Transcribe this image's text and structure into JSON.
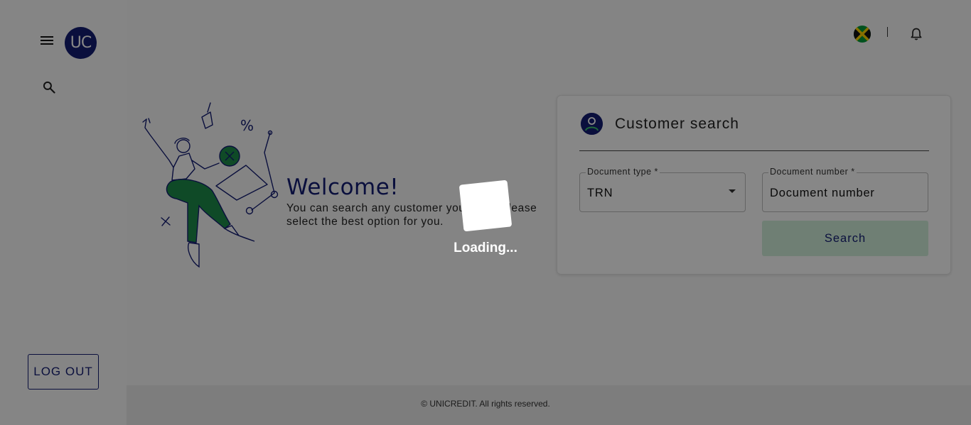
{
  "sidebar": {
    "logo_text": "UC",
    "menu_icon": "hamburger-menu-icon",
    "search_icon": "search-icon",
    "logout_label": "LOG OUT"
  },
  "topbar": {
    "flag_icon": "jamaica-flag-icon",
    "separator": "|",
    "bell_icon": "bell-icon"
  },
  "welcome": {
    "title": "Welcome!",
    "text": "You can search any customer you need, please select the best option for you."
  },
  "customer_search": {
    "title": "Customer search",
    "icon": "user-circle-icon",
    "document_type": {
      "label": "Document type *",
      "value": "TRN"
    },
    "document_number": {
      "label": "Document number *",
      "placeholder": "Document number"
    },
    "search_label": "Search"
  },
  "footer": {
    "text": "© UNICREDIT. All rights reserved."
  },
  "loading": {
    "text": "Loading..."
  },
  "colors": {
    "brand": "#141e74",
    "accent_green": "#1e8c4a",
    "search_button": "#d1f0dc"
  }
}
